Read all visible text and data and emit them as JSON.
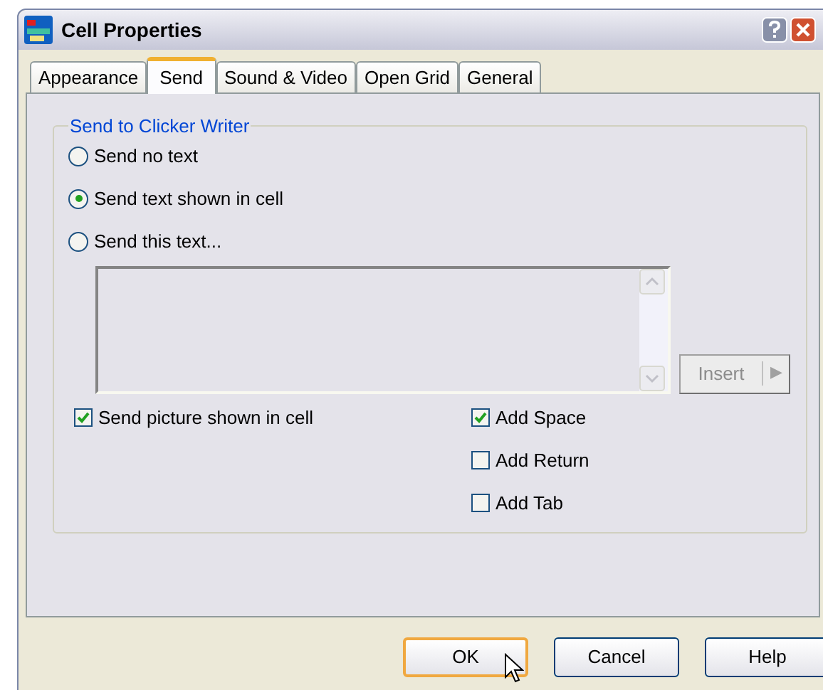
{
  "window": {
    "title": "Cell Properties"
  },
  "tabs": [
    {
      "label": "Appearance",
      "selected": false
    },
    {
      "label": "Send",
      "selected": true
    },
    {
      "label": "Sound & Video",
      "selected": false
    },
    {
      "label": "Open Grid",
      "selected": false
    },
    {
      "label": "General",
      "selected": false
    }
  ],
  "group": {
    "title": "Send to Clicker Writer",
    "radios": [
      {
        "label": "Send no text",
        "selected": false
      },
      {
        "label": "Send text shown in cell",
        "selected": true
      },
      {
        "label": "Send this text...",
        "selected": false
      }
    ],
    "insert_button": {
      "label": "Insert",
      "arrow": "▶",
      "disabled": true
    },
    "left_checks": [
      {
        "label": "Send picture shown in cell",
        "checked": true
      }
    ],
    "right_checks": [
      {
        "label": "Add Space",
        "checked": true
      },
      {
        "label": "Add Return",
        "checked": false
      },
      {
        "label": "Add Tab",
        "checked": false
      }
    ]
  },
  "buttons": [
    {
      "label": "OK",
      "default": true
    },
    {
      "label": "Cancel",
      "default": false
    },
    {
      "label": "Help",
      "default": false
    }
  ]
}
